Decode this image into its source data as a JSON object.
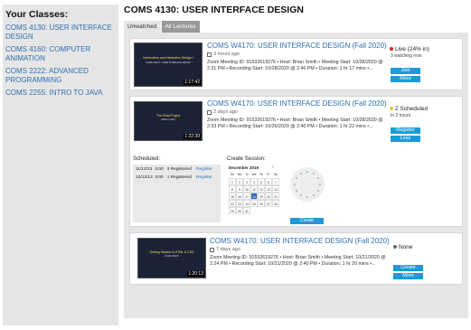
{
  "sidebar": {
    "heading": "Your Classes:",
    "classes": [
      {
        "label": "COMS 4130: USER INTERFACE DESIGN"
      },
      {
        "label": "COMS 4160: COMPUTER ANIMATION"
      },
      {
        "label": "COMS 2222: ADVANCED PROGRAMMING"
      },
      {
        "label": "COMS 2255: INTRO TO JAVA"
      }
    ]
  },
  "main": {
    "title": "COMS 4130: USER INTERFACE DESIGN",
    "tabs": [
      "Unwatched",
      "All Lectures"
    ],
    "active_tab": "All Lectures"
  },
  "lectures": [
    {
      "title": "COMS W4170: USER INTERFACE DESIGN (Fall 2020)",
      "ago": "3 hours ago",
      "thumb_title": "Information and Interaction Design I",
      "thumb_sub": "COMS W4170 • USER INTERFACE DESIGN",
      "duration": "1:17:42",
      "info_line1": "Zoom Meeting ID: 91532619276  • Host: Brian Smith  • Meeting Start: 10/28/2020 @",
      "info_line2": "2:31 PM   • Recording Start: 10/28/2020 @ 2:40 PM  • Duration: 1 hr 17 mins  •...",
      "status": "Live (24% in)",
      "status_color": "#e02020",
      "substatus": "3 watching now",
      "buttons": [
        "Join",
        "More"
      ]
    },
    {
      "title": "COMS W4170: USER INTERFACE DESIGN (Fall 2020)",
      "ago": "2 days ago",
      "thumb_title": "The Final Project",
      "thumb_sub": "Midterm 2003",
      "duration": "1:22:39",
      "info_line1": "Zoom Meeting ID: 91532619276  • Host: Brian Smith  • Meeting Start: 10/28/2020 @",
      "info_line2": "2:33 PM   • Recording Start: 10/26/2020 @ 2:40 PM  • Duration: 1 hr 22 mins  •...",
      "status": "2 Scheduled",
      "status_color": "#f2c12e",
      "substatus": "In 3 hours",
      "buttons": [
        "Register",
        "Less"
      ],
      "scheduled_label": "Scheduled:",
      "scheduled": [
        {
          "date": "11/12/13",
          "time": "3:00",
          "count": "3 Registered",
          "action": "Register"
        },
        {
          "date": "12/12/13",
          "time": "3:00",
          "count": "1 Registered",
          "action": "Register"
        }
      ],
      "create_label": "Create Session:",
      "calendar": {
        "month": "December 2019",
        "weekdays": [
          "Su",
          "Mo",
          "Tu",
          "We",
          "Th",
          "Fr",
          "Sa"
        ],
        "days": [
          "1",
          "2",
          "3",
          "4",
          "5",
          "6",
          "7",
          "8",
          "9",
          "10",
          "11",
          "12",
          "13",
          "14",
          "15",
          "16",
          "17",
          "18",
          "19",
          "20",
          "21",
          "22",
          "23",
          "24",
          "25",
          "26",
          "27",
          "28",
          "29",
          "30",
          "31"
        ],
        "selected": "18"
      },
      "create_button": "Create"
    },
    {
      "title": "COMS W4170: USER INTERFACE DESIGN (Fall 2020)",
      "ago": "7 days ago",
      "thumb_title": "Getting Started in HTML & CSS",
      "thumb_sub": "COMS W4170",
      "duration": "1:20:13",
      "info_line1": "Zoom Meeting ID: 91532619276  • Host: Brian Smith  • Meeting Start: 10/21/2020 @",
      "info_line2": "2:24 PM   • Recording Start: 10/21/2020 @ 2:40 PM  • Duration: 1 hr 20 mins  •...",
      "status": "None",
      "status_color": "#666666",
      "buttons": [
        "Create",
        "More"
      ]
    }
  ],
  "accent_color": "#1e9ad6",
  "link_color": "#2f6fb0"
}
